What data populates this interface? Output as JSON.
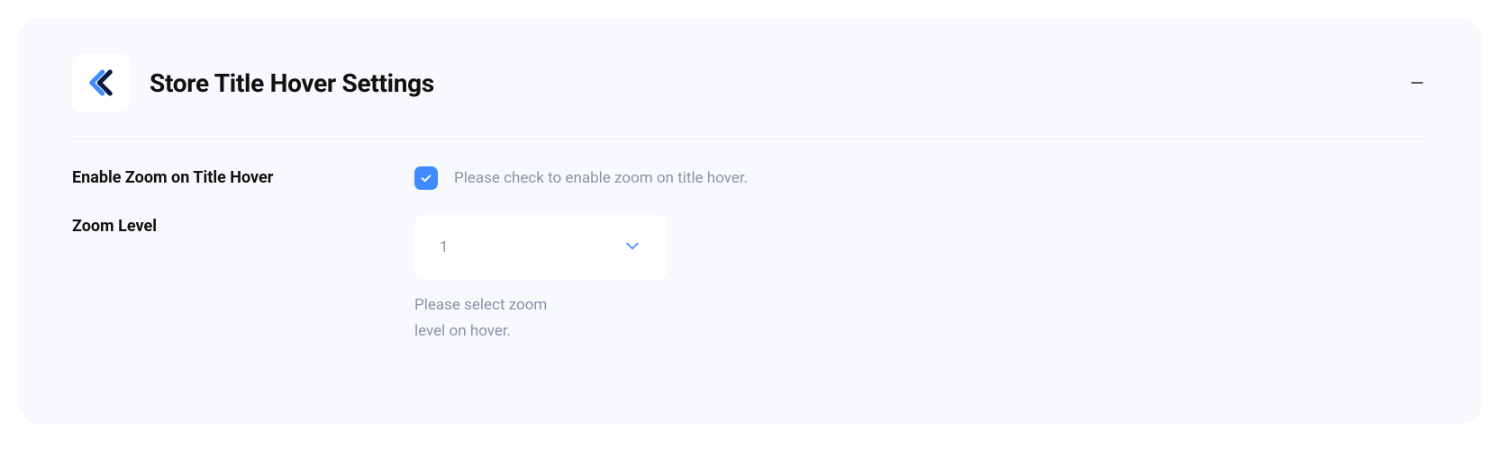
{
  "panel": {
    "title": "Store Title Hover Settings",
    "fields": {
      "enable_zoom": {
        "label": "Enable Zoom on Title Hover",
        "checked": true,
        "help": "Please check to enable zoom on title hover."
      },
      "zoom_level": {
        "label": "Zoom Level",
        "value": "1",
        "help": "Please select zoom level on hover."
      }
    }
  },
  "colors": {
    "accent": "#3f8cff",
    "panel_bg": "#f7f9fc",
    "text_muted": "#8a94a6"
  }
}
